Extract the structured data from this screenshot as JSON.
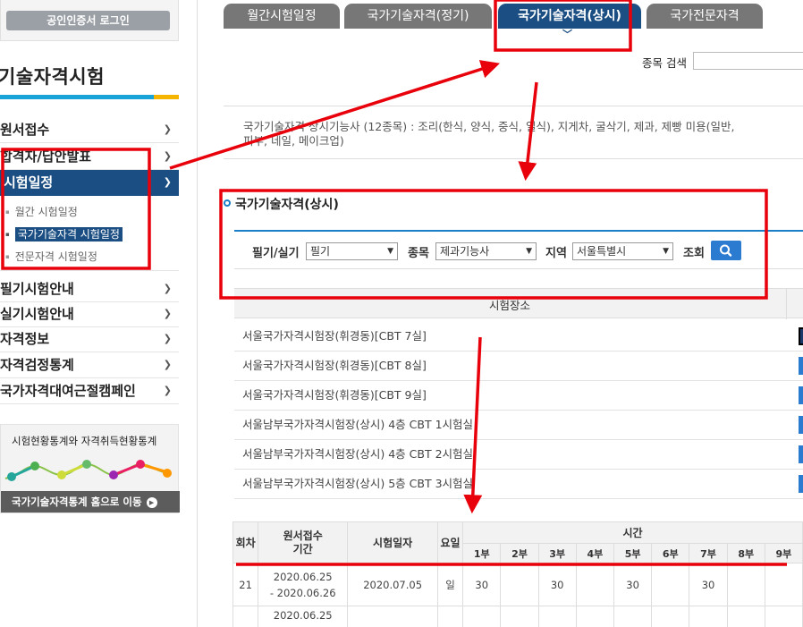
{
  "sidebar": {
    "login_label": "공인인증서 로그인",
    "title": "기술자격시험",
    "menu": [
      {
        "label": "원서접수"
      },
      {
        "label": "합격자/답안발표"
      },
      {
        "label": "시험일정"
      },
      {
        "label": "필기시험안내"
      },
      {
        "label": "실기시험안내"
      },
      {
        "label": "자격정보"
      },
      {
        "label": "자격검정통계"
      },
      {
        "label": "국가자격대여근절캠페인"
      }
    ],
    "submenu": [
      {
        "label": "월간 시험일정"
      },
      {
        "label": "국가기술자격 시험일정"
      },
      {
        "label": "전문자격 시험일정"
      }
    ],
    "stats": {
      "title": "시험현황통계와 자격취득현황통계",
      "link": "국가기술자격통계 홈으로 이동"
    }
  },
  "tabs": [
    {
      "label": "월간시험일정"
    },
    {
      "label": "국가기술자격(정기)"
    },
    {
      "label": "국가기술자격(상시)"
    },
    {
      "label": "국가전문자격"
    }
  ],
  "search": {
    "label": "종목 검색"
  },
  "description": "국가기술자격 상시기능사 (12종목) : 조리(한식, 양식, 중식, 일식), 지게차, 굴삭기, 제과, 제빵 미용(일반, 피부, 네일, 메이크업)",
  "section_title": "국가기술자격(상시)",
  "filters": {
    "type_label": "필기/실기",
    "type_value": "필기",
    "item_label": "종목",
    "item_value": "제과기능사",
    "region_label": "지역",
    "region_value": "서울특별시",
    "submit_label": "조회"
  },
  "places": {
    "header": "시험장소",
    "rows": [
      "서울국가자격시험장(휘경동)[CBT 7실]",
      "서울국가자격시험장(휘경동)[CBT 8실]",
      "서울국가자격시험장(휘경동)[CBT 9실]",
      "서울남부국가자격시험장(상시) 4층 CBT 1시험실",
      "서울남부국가자격시험장(상시) 4층 CBT 2시험실",
      "서울남부국가자격시험장(상시) 5층 CBT 3시험실"
    ]
  },
  "schedule": {
    "headers": {
      "round": "회차",
      "period": "원서접수\n기간",
      "date": "시험일자",
      "day": "요일",
      "time": "시간"
    },
    "slots": [
      "1부",
      "2부",
      "3부",
      "4부",
      "5부",
      "6부",
      "7부",
      "8부",
      "9부"
    ],
    "rows": [
      {
        "round": "21",
        "period_start": "2020.06.25",
        "period_end": "- 2020.06.26",
        "date": "2020.07.05",
        "day": "일",
        "slots": [
          "30",
          "",
          "30",
          "",
          "30",
          "",
          "30",
          "",
          ""
        ]
      },
      {
        "round": "",
        "period_start": "2020.06.25",
        "period_end": "",
        "date": "",
        "day": "",
        "slots": [
          "",
          "",
          "",
          "",
          "",
          "",
          "",
          "",
          ""
        ]
      }
    ]
  },
  "colors": {
    "primary": "#1b4e82",
    "accent": "#1aa3d9",
    "highlight": "#f4b400",
    "button": "#2b7bd0",
    "annotation": "#e8000b"
  }
}
